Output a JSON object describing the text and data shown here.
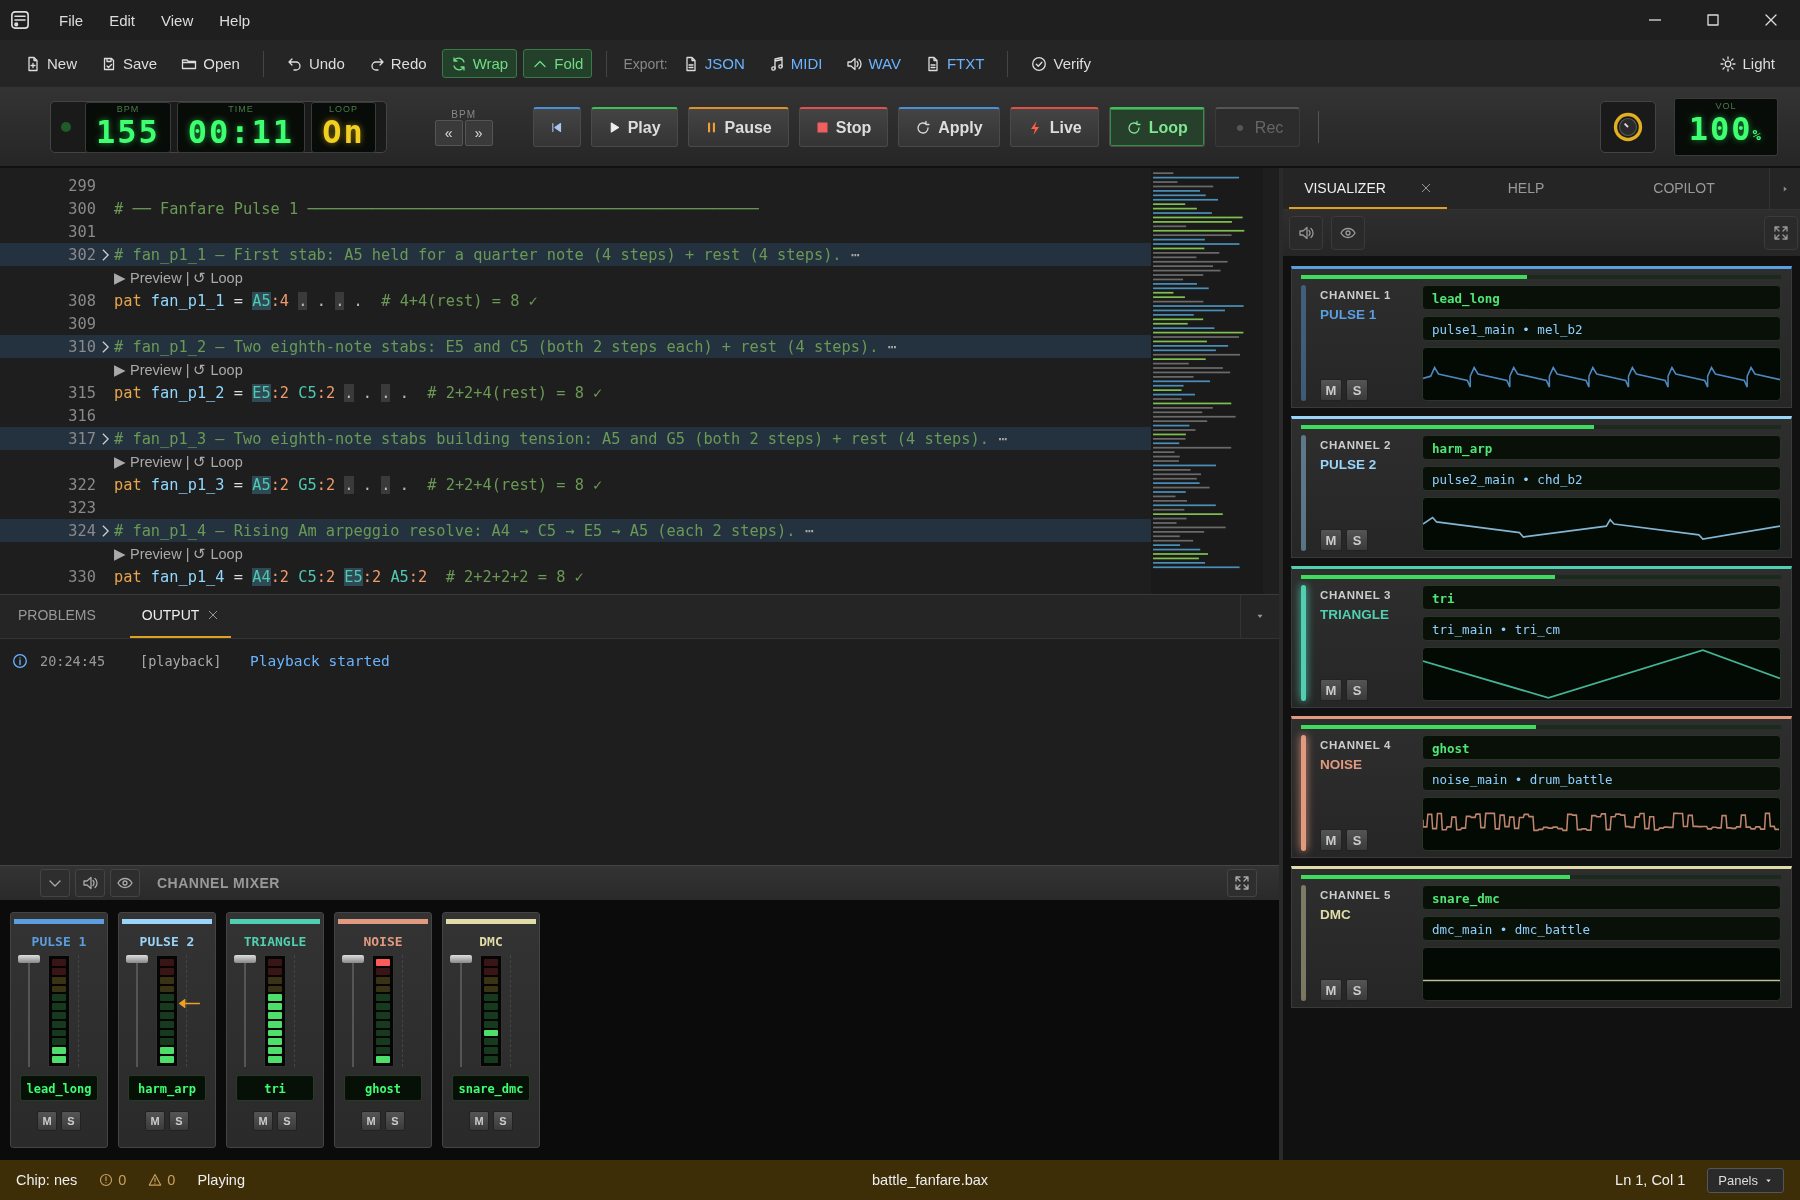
{
  "menu": [
    "File",
    "Edit",
    "View",
    "Help"
  ],
  "toolbar": {
    "groups": [
      [
        {
          "kind": "new",
          "label": "New",
          "on": false
        },
        {
          "kind": "save",
          "label": "Save",
          "on": false
        },
        {
          "kind": "open",
          "label": "Open",
          "on": false
        }
      ],
      [
        {
          "kind": "undo",
          "label": "Undo",
          "on": false
        },
        {
          "kind": "redo",
          "label": "Redo",
          "on": false
        },
        {
          "kind": "wrap",
          "label": "Wrap",
          "on": true
        },
        {
          "kind": "fold",
          "label": "Fold",
          "on": true
        }
      ],
      [
        {
          "kind": "label",
          "label": "Export:"
        },
        {
          "kind": "json",
          "label": "JSON",
          "on": false
        },
        {
          "kind": "midi",
          "label": "MIDI",
          "on": false
        },
        {
          "kind": "wav",
          "label": "WAV",
          "on": false
        },
        {
          "kind": "ftxt",
          "label": "FTXT",
          "on": false
        }
      ],
      [
        {
          "kind": "verify",
          "label": "Verify",
          "on": false
        }
      ]
    ],
    "theme_button": "Light"
  },
  "transport": {
    "displays": [
      {
        "label": "BPM",
        "value": "155",
        "kind": "green"
      },
      {
        "label": "TIME",
        "value": "00:11",
        "kind": "green"
      },
      {
        "label": "LOOP",
        "value": "On",
        "kind": "yellow"
      }
    ],
    "nudge": {
      "label": "BPM",
      "buttons": [
        "«",
        "»"
      ]
    },
    "buttons": [
      {
        "kind": "rewind",
        "color": "#4a8fd8",
        "on": false,
        "disabled": false
      },
      {
        "kind": "play",
        "label": "Play",
        "color": "#3fbf5a",
        "on": false,
        "disabled": false
      },
      {
        "kind": "pause",
        "label": "Pause",
        "color": "#e0902a",
        "on": false,
        "disabled": false
      },
      {
        "kind": "stop",
        "label": "Stop",
        "color": "#e05050",
        "on": false,
        "disabled": false
      },
      {
        "kind": "apply",
        "label": "Apply",
        "color": "#4a8fd8",
        "on": false,
        "disabled": false
      },
      {
        "kind": "live",
        "label": "Live",
        "color": "#e05040",
        "on": false,
        "disabled": false
      },
      {
        "kind": "loop",
        "label": "Loop",
        "color": "#3fbf5a",
        "on": true,
        "disabled": false
      },
      {
        "kind": "rec",
        "label": "Rec",
        "color": "#555555",
        "on": false,
        "disabled": true
      }
    ],
    "volume": {
      "label": "VOL",
      "value": "100",
      "unit": "%"
    }
  },
  "editor": {
    "lines": [
      {
        "kind": "blank",
        "num": "299"
      },
      {
        "kind": "comment",
        "num": "300",
        "text": "# ── Fanfare Pulse 1 ─────────────────────────────────────────────────"
      },
      {
        "kind": "blank",
        "num": "301"
      },
      {
        "kind": "fold",
        "num": "302",
        "text": "# fan_p1_1 — First stab: A5 held for a quarter note (4 steps) + rest (4 steps).",
        "more": "⋯"
      },
      {
        "kind": "lens",
        "items": [
          "▶ Preview",
          "↺ Loop"
        ],
        "sep": "|"
      },
      {
        "kind": "pat",
        "num": "308",
        "kw": "pat",
        "name": "fan_p1_1",
        "op": "=",
        "notes": [
          {
            "note": "A5",
            "dur": ":4",
            "hl": true
          }
        ],
        "rests": [
          {
            "text": ".",
            "hl": true
          },
          {
            "text": ".",
            "hl": false
          },
          {
            "text": ".",
            "hl": true
          },
          {
            "text": ".",
            "hl": false
          }
        ],
        "comment": "# 4+4(rest) = 8 ✓"
      },
      {
        "kind": "blank",
        "num": "309"
      },
      {
        "kind": "fold",
        "num": "310",
        "text": "# fan_p1_2 — Two eighth-note stabs: E5 and C5 (both 2 steps each) + rest (4 steps).",
        "more": "⋯"
      },
      {
        "kind": "lens",
        "items": [
          "▶ Preview",
          "↺ Loop"
        ],
        "sep": "|"
      },
      {
        "kind": "pat",
        "num": "315",
        "kw": "pat",
        "name": "fan_p1_2",
        "op": "=",
        "notes": [
          {
            "note": "E5",
            "dur": ":2",
            "hl": true
          },
          {
            "note": "C5",
            "dur": ":2",
            "hl": false
          }
        ],
        "rests": [
          {
            "text": ".",
            "hl": true
          },
          {
            "text": ".",
            "hl": false
          },
          {
            "text": ".",
            "hl": true
          },
          {
            "text": ".",
            "hl": false
          }
        ],
        "comment": "# 2+2+4(rest) = 8 ✓"
      },
      {
        "kind": "blank",
        "num": "316"
      },
      {
        "kind": "fold",
        "num": "317",
        "text": "# fan_p1_3 — Two eighth-note stabs building tension: A5 and G5 (both 2 steps) + rest (4 steps).",
        "more": "⋯"
      },
      {
        "kind": "lens",
        "items": [
          "▶ Preview",
          "↺ Loop"
        ],
        "sep": "|"
      },
      {
        "kind": "pat",
        "num": "322",
        "kw": "pat",
        "name": "fan_p1_3",
        "op": "=",
        "notes": [
          {
            "note": "A5",
            "dur": ":2",
            "hl": true
          },
          {
            "note": "G5",
            "dur": ":2",
            "hl": false
          }
        ],
        "rests": [
          {
            "text": ".",
            "hl": true
          },
          {
            "text": ".",
            "hl": false
          },
          {
            "text": ".",
            "hl": true
          },
          {
            "text": ".",
            "hl": false
          }
        ],
        "comment": "# 2+2+4(rest) = 8 ✓"
      },
      {
        "kind": "blank",
        "num": "323"
      },
      {
        "kind": "fold",
        "num": "324",
        "text": "# fan_p1_4 — Rising Am arpeggio resolve: A4 → C5 → E5 → A5 (each 2 steps).",
        "more": "⋯"
      },
      {
        "kind": "lens",
        "items": [
          "▶ Preview",
          "↺ Loop"
        ],
        "sep": "|"
      },
      {
        "kind": "pat",
        "num": "330",
        "kw": "pat",
        "name": "fan_p1_4",
        "op": "=",
        "notes": [
          {
            "note": "A4",
            "dur": ":2",
            "hl": true
          },
          {
            "note": "C5",
            "dur": ":2",
            "hl": false
          },
          {
            "note": "E5",
            "dur": ":2",
            "hl": true
          },
          {
            "note": "A5",
            "dur": ":2",
            "hl": false
          }
        ],
        "comment": "# 2+2+2+2 = 8 ✓"
      }
    ]
  },
  "output": {
    "tabs": [
      {
        "label": "PROBLEMS",
        "selected": false
      },
      {
        "label": "OUTPUT",
        "selected": true
      }
    ],
    "entries": [
      {
        "time": "20:24:45",
        "tag": "[playback]",
        "message": "Playback started"
      }
    ]
  },
  "mixer": {
    "title": "CHANNEL MIXER",
    "strips": [
      {
        "name": "PULSE 1",
        "color": "#5a9ee0",
        "level": 1,
        "pattern": "lead_long",
        "mute": "M",
        "solo": "S",
        "marker": false,
        "segments": [
          true,
          true,
          false,
          false,
          false,
          false,
          false,
          false,
          false,
          false,
          false,
          false
        ]
      },
      {
        "name": "PULSE 2",
        "color": "#9ad4f8",
        "level": 1,
        "pattern": "harm_arp",
        "mute": "M",
        "solo": "S",
        "marker": true,
        "segments": [
          true,
          true,
          false,
          false,
          false,
          false,
          false,
          false,
          false,
          false,
          false,
          false
        ]
      },
      {
        "name": "TRIANGLE",
        "color": "#4fd0b0",
        "level": 1,
        "pattern": "tri",
        "mute": "M",
        "solo": "S",
        "marker": false,
        "segments": [
          true,
          true,
          true,
          true,
          true,
          true,
          true,
          true,
          false,
          false,
          false,
          false
        ]
      },
      {
        "name": "NOISE",
        "color": "#e09a80",
        "level": 1,
        "pattern": "ghost",
        "mute": "M",
        "solo": "S",
        "marker": false,
        "segments": [
          true,
          false,
          false,
          false,
          false,
          false,
          false,
          false,
          false,
          false,
          false,
          true
        ]
      },
      {
        "name": "DMC",
        "color": "#e0dca8",
        "level": 1,
        "pattern": "snare_dmc",
        "mute": "M",
        "solo": "S",
        "marker": false,
        "segments": [
          false,
          false,
          false,
          true,
          false,
          false,
          false,
          false,
          false,
          false,
          false,
          false
        ]
      }
    ]
  },
  "side_panel": {
    "tabs": [
      {
        "label": "VISUALIZER",
        "selected": true
      },
      {
        "label": "HELP",
        "selected": false
      },
      {
        "label": "COPILOT",
        "selected": false
      }
    ],
    "channels": [
      {
        "channel": "CHANNEL 1",
        "name": "PULSE 1",
        "color": "#5a9ee0",
        "active": false,
        "level": 0.47,
        "pattern": "lead_long",
        "path": "pulse1_main • mel_b2",
        "mute": "M",
        "solo": "S",
        "kind": "pulse"
      },
      {
        "channel": "CHANNEL 2",
        "name": "PULSE 2",
        "color": "#9ad4f8",
        "active": false,
        "level": 0.61,
        "pattern": "harm_arp",
        "path": "pulse2_main • chd_b2",
        "mute": "M",
        "solo": "S",
        "kind": "sweep"
      },
      {
        "channel": "CHANNEL 3",
        "name": "TRIANGLE",
        "color": "#4fd0b0",
        "active": true,
        "level": 0.53,
        "pattern": "tri",
        "path": "tri_main • tri_cm",
        "mute": "M",
        "solo": "S",
        "kind": "triangle"
      },
      {
        "channel": "CHANNEL 4",
        "name": "NOISE",
        "color": "#e09a80",
        "active": true,
        "level": 0.49,
        "pattern": "ghost",
        "path": "noise_main • drum_battle",
        "mute": "M",
        "solo": "S",
        "kind": "noise"
      },
      {
        "channel": "CHANNEL 5",
        "name": "DMC",
        "color": "#e0dca8",
        "active": false,
        "level": 0.56,
        "pattern": "snare_dmc",
        "path": "dmc_main • dmc_battle",
        "mute": "M",
        "solo": "S",
        "kind": "flat"
      }
    ]
  },
  "status_bar": {
    "chip": "Chip: nes",
    "errors": "0",
    "warnings": "0",
    "state": "Playing",
    "file": "battle_fanfare.bax",
    "position": "Ln 1, Col 1",
    "panels": "Panels"
  }
}
